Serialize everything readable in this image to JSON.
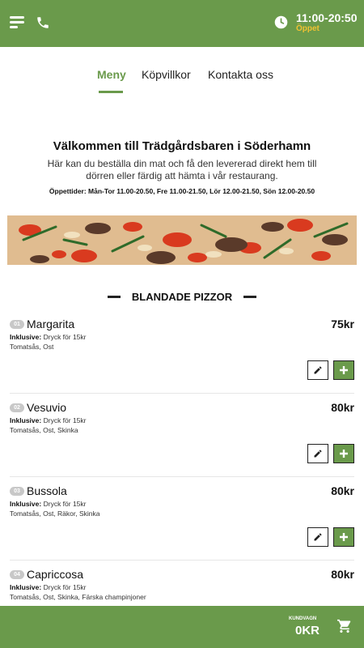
{
  "header": {
    "hours": "11:00-20:50",
    "status": "Öppet",
    "icons": {
      "menu": "menu-icon",
      "phone": "phone-icon",
      "clock": "clock-icon"
    }
  },
  "nav": {
    "tabs": [
      {
        "label": "Meny",
        "active": true
      },
      {
        "label": "Köpvillkor",
        "active": false
      },
      {
        "label": "Kontakta oss",
        "active": false
      }
    ]
  },
  "welcome": {
    "title": "Välkommen till Trädgårdsbaren i Söderhamn",
    "description": "Här kan du beställa din mat och få den levererad direkt hem till dörren eller färdig att hämta i vår restaurang.",
    "opening_hours": "Öppettider: Mån-Tor 11.00-20.50, Fre 11.00-21.50, Lör 12.00-21.50, Sön 12.00-20.50"
  },
  "section": {
    "title": "BLANDADE PIZZOR"
  },
  "items": [
    {
      "num": "01",
      "name": "Margarita",
      "price": "75kr",
      "incl_label": "Inklusive:",
      "incl_value": "Dryck för 15kr",
      "ingredients": "Tomatsås, Ost"
    },
    {
      "num": "02",
      "name": "Vesuvio",
      "price": "80kr",
      "incl_label": "Inklusive:",
      "incl_value": "Dryck för 15kr",
      "ingredients": "Tomatsås, Ost, Skinka"
    },
    {
      "num": "03",
      "name": "Bussola",
      "price": "80kr",
      "incl_label": "Inklusive:",
      "incl_value": "Dryck för 15kr",
      "ingredients": "Tomatsås, Ost, Räkor, Skinka"
    },
    {
      "num": "04",
      "name": "Capriccosa",
      "price": "80kr",
      "incl_label": "Inklusive:",
      "incl_value": "Dryck för 15kr",
      "ingredients": "Tomatsås, Ost, Skinka, Färska champinjoner"
    }
  ],
  "cart": {
    "label": "KUNDVAGN",
    "amount": "0KR",
    "icon": "cart-icon"
  },
  "colors": {
    "brand_green": "#6a9a4b",
    "status_yellow": "#f1c232"
  }
}
